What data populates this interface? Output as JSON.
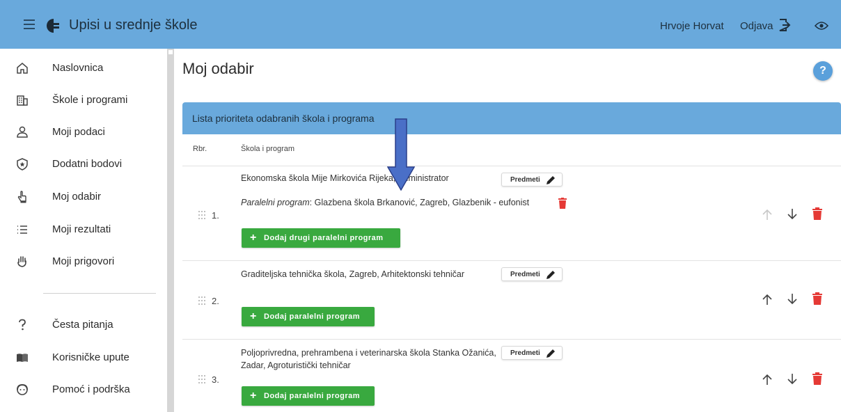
{
  "header": {
    "app_title": "Upisi u srednje škole",
    "user_name": "Hrvoje Horvat",
    "logout_label": "Odjava",
    "bar_color": "#69a9dc"
  },
  "sidebar": {
    "items": [
      {
        "label": "Naslovnica",
        "icon": "home-icon"
      },
      {
        "label": "Škole i programi",
        "icon": "building-icon"
      },
      {
        "label": "Moji podaci",
        "icon": "user-icon"
      },
      {
        "label": "Dodatni bodovi",
        "icon": "star-shield-icon"
      },
      {
        "label": "Moj odabir",
        "icon": "hand-pointer-icon"
      },
      {
        "label": "Moji rezultati",
        "icon": "list-icon"
      },
      {
        "label": "Moji prigovori",
        "icon": "hand-icon"
      }
    ],
    "secondary_items": [
      {
        "label": "Česta pitanja",
        "icon": "question-icon"
      },
      {
        "label": "Korisničke upute",
        "icon": "book-icon"
      },
      {
        "label": "Pomoć i podrška",
        "icon": "support-icon"
      }
    ]
  },
  "main": {
    "page_title": "Moj odabir",
    "help_label": "?",
    "card_title": "Lista prioriteta odabranih škola i programa",
    "columns": [
      "Rbr.",
      "Škola i program"
    ],
    "predmeti_label": "Predmeti",
    "rows": [
      {
        "num": "1.",
        "school": "Ekonomska škola Mije Mirkovića Rijeka, Administrator",
        "parallel_label": "Paralelni program",
        "parallel_value": ": Glazbena škola Brkanović, Zagreb, Glazbenik - eufonist",
        "button_label": "Dodaj drugi paralelni program"
      },
      {
        "num": "2.",
        "school": "Graditeljska tehnička škola, Zagreb, Arhitektonski tehničar",
        "button_label": "Dodaj paralelni program"
      },
      {
        "num": "3.",
        "school": "Poljoprivredna, prehrambena i veterinarska škola Stanka Ožanića, Zadar, Agroturistički tehničar",
        "button_label": "Dodaj paralelni program"
      }
    ],
    "plus_symbol": "+",
    "colors": {
      "green": "#39a93f",
      "delete": "#e53935",
      "blue_arrow": "#4a6fc7"
    }
  }
}
